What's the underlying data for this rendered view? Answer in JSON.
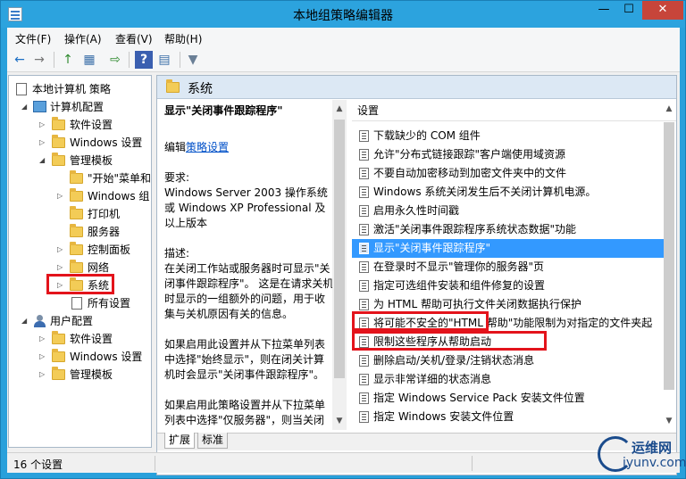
{
  "window": {
    "title": "本地组策略编辑器",
    "min_label": "—",
    "max_label": "☐",
    "close_label": "✕"
  },
  "menu": {
    "file": "文件(F)",
    "action": "操作(A)",
    "view": "查看(V)",
    "help": "帮助(H)"
  },
  "toolbar": {
    "back": "←",
    "forward": "→",
    "up": "↑",
    "show_tree": "▦",
    "export": "⇨",
    "help": "?",
    "properties": "▤",
    "filter": "▼"
  },
  "tree": {
    "root": "本地计算机 策略",
    "computer_config": "计算机配置",
    "software_settings": "软件设置",
    "windows_settings": "Windows 设置",
    "admin_templates": "管理模板",
    "start_menu": "\"开始\"菜单和",
    "windows_components": "Windows 组",
    "printers": "打印机",
    "server": "服务器",
    "control_panel": "控制面板",
    "network": "网络",
    "system": "系统",
    "all_settings": "所有设置",
    "user_config": "用户配置",
    "user_software_settings": "软件设置",
    "user_windows_settings": "Windows 设置",
    "user_admin_templates": "管理模板"
  },
  "pane": {
    "header_title": "系统",
    "desc_title": "显示\"关闭事件跟踪程序\"",
    "edit_prefix": "编辑",
    "edit_link": "策略设置",
    "requirements_label": "要求:",
    "requirements_text": "Windows Server 2003 操作系统或 Windows XP Professional 及以上版本",
    "description_label": "描述:",
    "description_text": "在关闭工作站或服务器时可显示\"关闭事件跟踪程序\"。 这是在请求关机时显示的一组额外的问题，用于收集与关机原因有关的信息。",
    "description_text2": "如果启用此设置并从下拉菜单列表中选择\"始终显示\"，则在闭关计算机时会显示\"关闭事件跟踪程序\"。",
    "description_text3": "如果启用此策略设置并从下拉菜单列表中选择\"仅服务器\"，则当关闭"
  },
  "list": {
    "header": "设置",
    "rows": [
      "下载缺少的 COM 组件",
      "允许\"分布式链接跟踪\"客户端使用域资源",
      "不要自动加密移动到加密文件夹中的文件",
      "Windows 系统关闭发生后不关闭计算机电源。",
      "启用永久性时间戳",
      "激活\"关闭事件跟踪程序系统状态数据\"功能",
      "显示\"关闭事件跟踪程序\"",
      "在登录时不显示\"管理你的服务器\"页",
      "指定可选组件安装和组件修复的设置",
      "为 HTML 帮助可执行文件关闭数据执行保护",
      "将可能不安全的\"HTML 帮助\"功能限制为对指定的文件夹起",
      "限制这些程序从帮助启动",
      "删除启动/关机/登录/注销状态消息",
      "显示非常详细的状态消息",
      "指定 Windows Service Pack 安装文件位置",
      "指定 Windows 安装文件位置"
    ],
    "selected_index": 6
  },
  "tabs": {
    "extended": "扩展",
    "standard": "标准"
  },
  "status": {
    "count": "16 个设置"
  },
  "watermark": {
    "name": "运维网",
    "url": "iyunv.com"
  },
  "colors": {
    "titlebar": "#2ca3de",
    "selection": "#3399ff",
    "highlight_box": "#e3131b",
    "link": "#0050c8"
  }
}
